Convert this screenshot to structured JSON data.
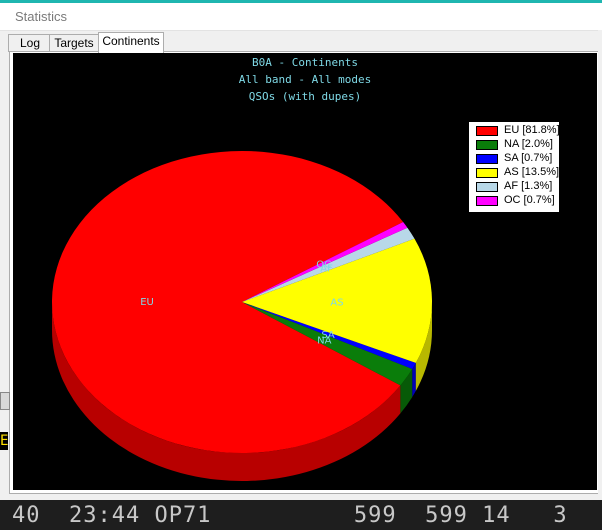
{
  "window": {
    "title": "Statistics"
  },
  "tabs": [
    {
      "label": "Log",
      "active": false
    },
    {
      "label": "Targets",
      "active": false
    },
    {
      "label": "Continents",
      "active": true
    }
  ],
  "chart_data": {
    "type": "pie",
    "title": "B0A - Continents",
    "subtitle": "All band - All modes",
    "subtitle2": "QSOs (with dupes)",
    "categories": [
      "EU",
      "NA",
      "SA",
      "AS",
      "AF",
      "OC"
    ],
    "values": [
      81.8,
      2.0,
      0.7,
      13.5,
      1.3,
      0.7
    ],
    "legend": [
      "EU [81.8%]",
      "NA [2.0%]",
      "SA [0.7%]",
      "AS [13.5%]",
      "AF [1.3%]",
      "OC [0.7%]"
    ],
    "colors": [
      "#ff0000",
      "#0a7d0a",
      "#0000ff",
      "#ffff00",
      "#b8d8e8",
      "#ff00ff"
    ],
    "legend_position": "top-right",
    "style": "3d"
  },
  "background_log": {
    "text": "40  23:44 OP71          599  599 14   3"
  },
  "left_fragment": "E"
}
